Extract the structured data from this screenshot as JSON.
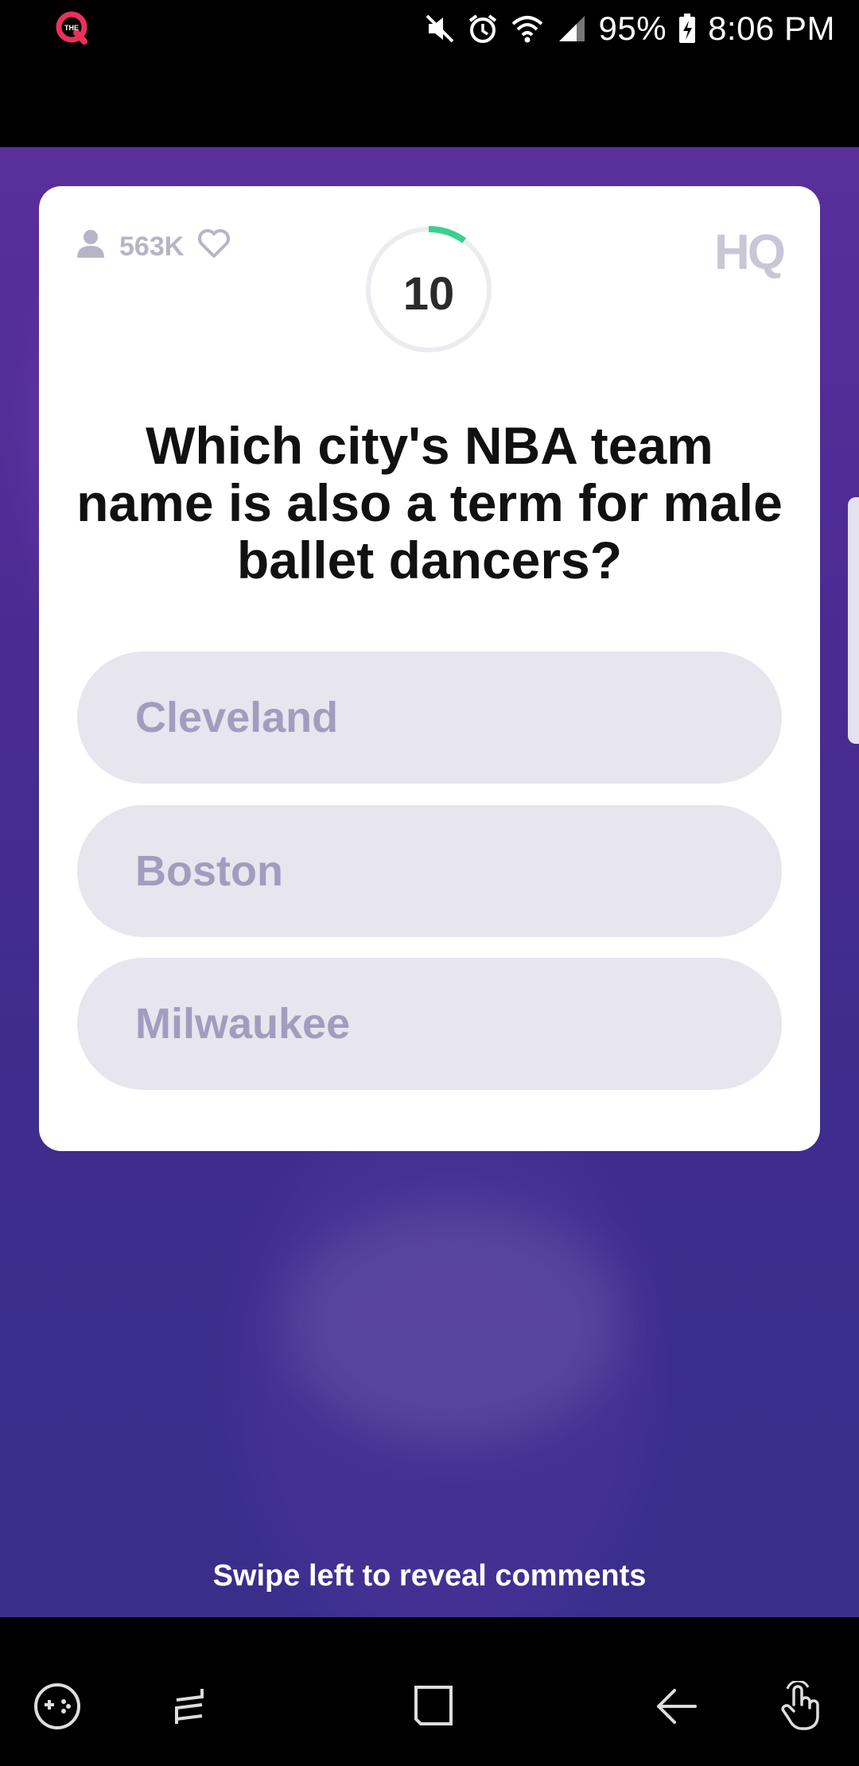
{
  "status_bar": {
    "app_badge": "THE",
    "battery": "95%",
    "time": "8:06 PM",
    "icons": [
      "mute-icon",
      "alarm-icon",
      "wifi-icon",
      "signal-icon",
      "battery-charging-icon"
    ]
  },
  "card": {
    "viewer_count": "563K",
    "timer": "10",
    "timer_progress_fraction": 0.1,
    "logo": "HQ",
    "question": "Which city's NBA team name is also a term for male ballet dancers?",
    "answers": [
      "Cleveland",
      "Boston",
      "Milwaukee"
    ]
  },
  "footer": {
    "swipe_hint": "Swipe left to reveal comments"
  },
  "nav": {
    "icons": [
      "game-launcher-icon",
      "recent-apps-icon",
      "home-icon",
      "back-icon",
      "touch-gesture-icon"
    ]
  },
  "colors": {
    "accent_timer": "#3ccf8e",
    "brand_pink": "#e8315b",
    "answer_bg": "#e7e5ee",
    "answer_text": "#a29dbe",
    "background_purple": "#4a2b92"
  }
}
